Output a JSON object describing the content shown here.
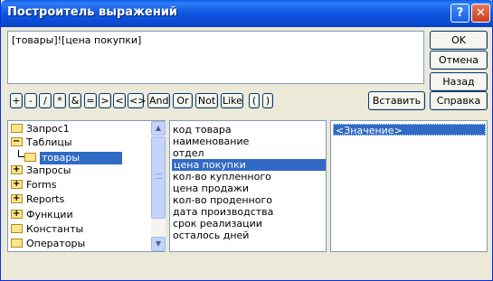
{
  "window": {
    "title": "Построитель выражений",
    "help_label": "?",
    "close_label": "✕"
  },
  "expression": {
    "value": "[товары]![цена покупки]"
  },
  "side_buttons": {
    "ok": "OK",
    "cancel": "Отмена",
    "back": "Назад",
    "paste": "Вставить",
    "help": "Справка"
  },
  "operators": [
    "+",
    "-",
    "/",
    "*",
    "&",
    "=",
    ">",
    "<",
    "<>",
    "And",
    "Or",
    "Not",
    "Like",
    "(",
    ")"
  ],
  "tree": {
    "items": [
      {
        "label": "Запрос1",
        "icon": "folder-icon"
      },
      {
        "label": "Таблицы",
        "icon": "folder-icon"
      },
      {
        "label": "товары",
        "icon": "open-folder-icon"
      },
      {
        "label": "Запросы",
        "icon": "folder-plus-icon"
      },
      {
        "label": "Forms",
        "icon": "folder-plus-icon"
      },
      {
        "label": "Reports",
        "icon": "folder-plus-icon"
      },
      {
        "label": "Функции",
        "icon": "folder-plus-icon"
      },
      {
        "label": "Константы",
        "icon": "folder-icon"
      },
      {
        "label": "Операторы",
        "icon": "folder-icon"
      }
    ]
  },
  "fields": {
    "items": [
      "код товара",
      "наименование",
      "отдел",
      "цена покупки",
      "кол-во купленного",
      "цена продажи",
      "кол-во проденного",
      "дата производства",
      "срок реализации",
      "осталось дней"
    ],
    "selected": "цена покупки"
  },
  "values": {
    "items": [
      "<Значение>"
    ]
  },
  "colors": {
    "selection": "#316ac5",
    "titlebar": "#0a5fe8"
  }
}
